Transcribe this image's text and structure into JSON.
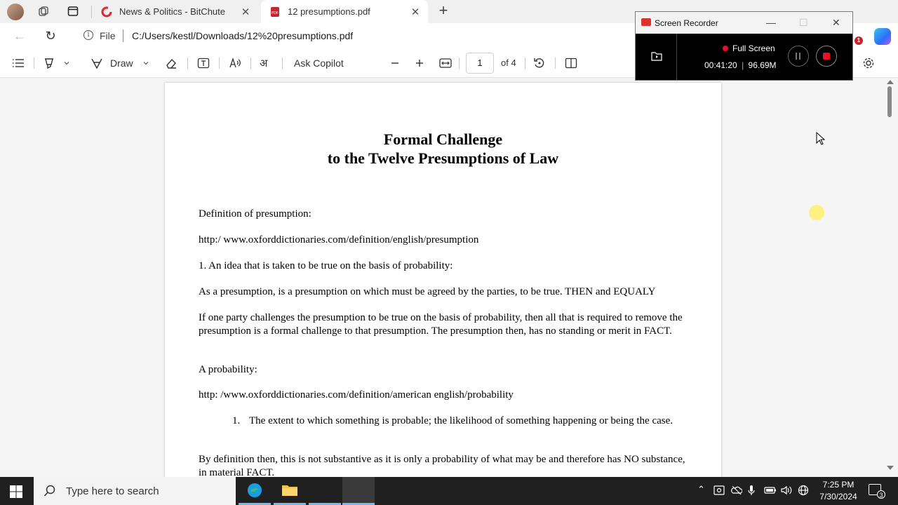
{
  "browser": {
    "tabs": [
      {
        "title": "News & Politics - BitChute",
        "active": false
      },
      {
        "title": "12 presumptions.pdf",
        "active": true
      }
    ],
    "address": {
      "scheme_label": "File",
      "url": "C:/Users/kestl/Downloads/12%20presumptions.pdf"
    },
    "notification_count": "1"
  },
  "pdf_toolbar": {
    "draw_label": "Draw",
    "ask_copilot_label": "Ask Copilot",
    "page_number": "1",
    "page_total": "of 4"
  },
  "document": {
    "title_line1": "Formal Challenge",
    "title_line2": "to the Twelve Presumptions of Law",
    "paragraphs": [
      "Definition of presumption:",
      "http:/ www.oxforddictionaries.com/definition/english/presumption",
      "1.   An idea that is taken to be true on the basis of probability:",
      "As a presumption, is a presumption on which must be agreed by the parties, to be true. THEN and EQUALY",
      "If one party challenges the presumption to be true on the basis of probability, then all that is required to remove the presumption is a formal challenge to that presumption. The presumption then, has no standing or merit in FACT.",
      "A probability:",
      "http: /www.oxforddictionaries.com/definition/american english/probability",
      "By definition then, this is not substantive as it is only a probability of what may be and therefore has NO substance, in material FACT."
    ],
    "list_item": {
      "number": "1.",
      "text": "The extent to which something is probable; the likelihood of something happening or being the case."
    }
  },
  "recorder": {
    "title": "Screen Recorder",
    "mode": "Full Screen",
    "elapsed": "00:41:20",
    "size": "96.69M",
    "divider": "|"
  },
  "taskbar": {
    "search_placeholder": "Type here to search",
    "time": "7:25 PM",
    "date": "7/30/2024",
    "notification_count": "3"
  }
}
